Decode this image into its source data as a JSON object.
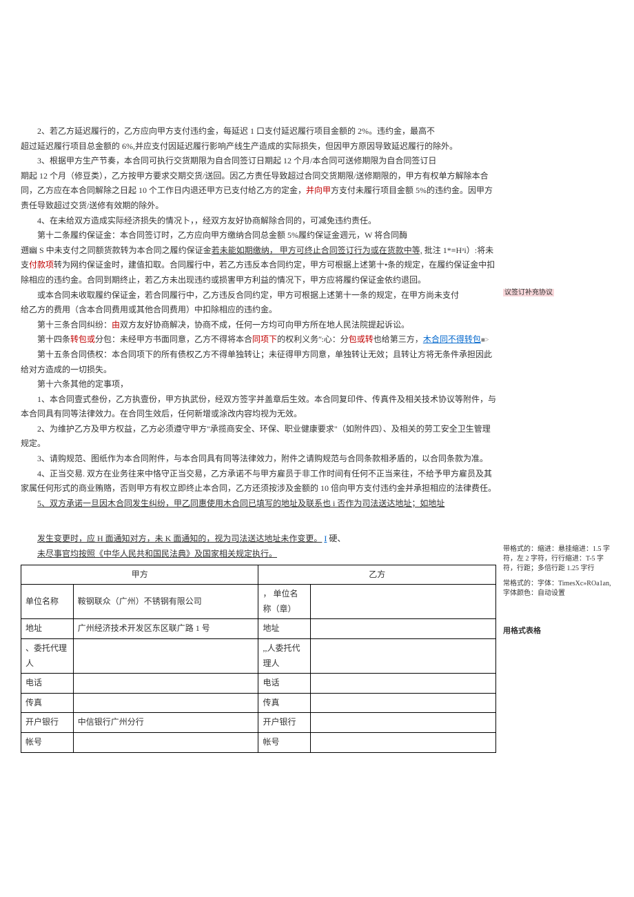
{
  "paragraphs": {
    "p1": "2、若乙方延迟履行的，乙方应向甲方支付违约金，每延迟 1 口支付延迟履行项目金额的 2%。违约金，最高不",
    "p1b": "超过延迟履行项目总金额的 6%,并应支付因延迟履行影响产线生产造成的实际损失，但因甲方原因导致延迟履行的除外。",
    "p2": "3、根据甲方生产节奏，本合同可执行交货期限为自合同签订日期起 12 个月/本合同可送修期限为自合同签订日",
    "p2b": "期起 12 个月（修豆类），乙方按甲方要求交期交货/送回。因乙方责任导致超过合同交货期限/送修期限的，甲方有权单方解除本合同，乙方应在本合同解除之日起 10 个工作日内退还甲方已支付给乙方的定金，",
    "p2red": "并向甲",
    "p2c": "方支付未履行项目金额 5%的违约金。因甲方责任导致超过交货/送修有效期的除外。",
    "p3": "4、在未给双方造成实际经济损失的情况卜，，经双方友好协商解除合同的，可减免违约责任。",
    "p4": "第十二条履约保证金：本合同签订时，乙方应向甲方缴纳合同总金额 5%履约保证金週元，W 将合同酶",
    "p4b_a": "遡幽 S 中未支付之同额货款转为本合同之履约保证金",
    "p4b_under": "若未能如期缴纳， 甲方可终止合同签订行为或在货款中等,",
    "p4b_b": " 批注 1*≡Hᵃi）:将未支",
    "p4b_red": "付款项",
    "p4b_c": "转为网约保证金时，建值扣取。合同履行中，若乙方违反本合同约定，甲方可根据上述第十•条的规定，在履约保证金中扣除相应的违约金。合同到期终止，若乙方未出现违约或损害甲方利益的情况下，甲方应将履约保证金依约退回。",
    "p5": "或本合同未收取履约保证金，若合同履行中，乙方违反合同约定，甲方可根据上述第十一条的规定，在甲方尚未支付",
    "p5b": "给乙方的费用（含本合同费用或其他合同费用）中扣除相应的违约金。",
    "comment1": "议签订补充协议",
    "p6a": "第十三条合同纠纷：",
    "p6red": "由",
    "p6b": "双方友好协商解决，协商不成，任何一方均可向甲方所在地人民法院提起诉讼。",
    "p7a": "第十四条",
    "p7red1": "转包或",
    "p7b": "分包：未经甲方书面同意，乙方不得将本合",
    "p7red2": "同项下",
    "p7c": "的权利义务ʺ:心：分",
    "p7red3": "包或转",
    "p7d": "也给第三方，",
    "p7blue": "木合同不得转包",
    "p7marker": "■>",
    "p8": "第十五条合同债权：本合同项下的所有债权乙方不得单独转让；未征得甲方同意，单独转让无效；且转让方将无条件承担因此给对方造成的一切损失。",
    "p9": "第十六条其他的定事项，",
    "p10": "1、本合同壹式叁份，乙方执壹份，甲方执武份，经双方签字并盖章后生效。本合同复印件、传真件及相关技术协议等附件，与本合同具有同等法律效力。在合同生效后，任何新增或涂改内容均视为无效。",
    "p11": "2、为维护乙方及甲方权益，乙方必须遵守甲方\"承揽商安全、环保、职业健康要求\"（如附件四）、及相关的劳工安全卫生管理规定。",
    "p12": "3、请购规范、图纸作为本合同附件，与本合同具有同等法律效力，附件之请购规范与合同条款相矛盾的，以合同条款为准。",
    "p13": "4、正当交易. 双方在业务往来中恪守正当交易，乙方承诺不与甲方雇员于非工作时间有任何不正当来往，不给予甲方雇员及其家属任何形式的商业贿赂，否则甲方有权立即终止本合同，乙方还须按涉及金额的 10 倍向甲方支付违约金并承担相应的法律费任。",
    "p14": "5、双方承诺一旦因木合同发生纠纷，甲乙同惠使用木合同已填写的地址及联系也 i 否作为司法送达地址；如地址",
    "p15a": "发生变更时，应 H 面通知对方，未 K 面通知的，视为司法送达地址未作变更。",
    "p15blue": "I",
    "p15b": "硬、",
    "p16": "未尽事官均按照《中华人民共和国民法典》及国家相关规定执行。"
  },
  "side_notes": {
    "n1a": "带格式的：缩进：悬挂缩进：1.5 字符，左 2 字符，行行缩进：T-5 字符，行距；多倍行距 1.25 字行",
    "n1b": "常格式的：字体：TimesXc»ROa1an, 字体颜色：自动设置",
    "n2": "用格式表格"
  },
  "table": {
    "header_left": "甲方",
    "header_right": "乙方",
    "rows": [
      {
        "l1": "单位名称",
        "l2": "鞍钢联众（广州）不锈钢有限公司",
        "r1": "， 单位名称（章）",
        "r2": ""
      },
      {
        "l1": "地址",
        "l2": "广州经济技术开发区东区联广路 1 号",
        "r1": "地址",
        "r2": ""
      },
      {
        "l1": "、委托代理人",
        "l2": "",
        "r1": ",,人委托代理人",
        "r2": ""
      },
      {
        "l1": "电话",
        "l2": "",
        "r1": "电话",
        "r2": ""
      },
      {
        "l1": "传真",
        "l2": "",
        "r1": "传真",
        "r2": ""
      },
      {
        "l1": "开户银行",
        "l2": "中信银行广州分行",
        "r1": "开户银行",
        "r2": ""
      },
      {
        "l1": "帐号",
        "l2": "",
        "r1": "帐号",
        "r2": ""
      }
    ]
  }
}
